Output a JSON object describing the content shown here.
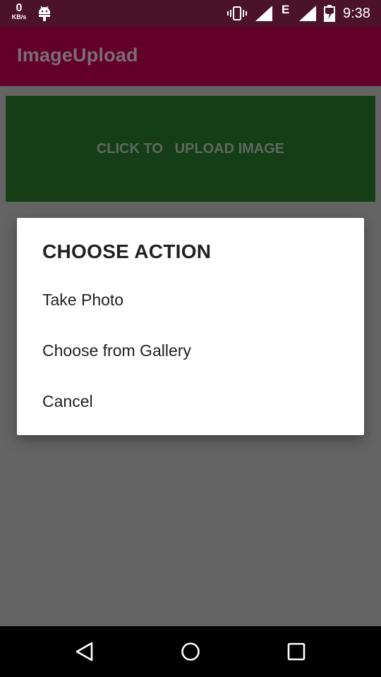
{
  "status_bar": {
    "speed_value": "0",
    "speed_unit": "KB/s",
    "network_type": "E",
    "time": "9:38",
    "icons": [
      "android-icon",
      "vibrate-icon",
      "signal-icon",
      "signal-icon",
      "battery-charging-icon"
    ]
  },
  "app_bar": {
    "title": "ImageUpload",
    "color": "#63002a"
  },
  "upload_button": {
    "label_part1": "CLICK TO",
    "label_part2": "UPLOAD IMAGE",
    "color": "#153d16"
  },
  "dialog": {
    "title": "CHOOSE ACTION",
    "items": [
      "Take Photo",
      "Choose from Gallery",
      "Cancel"
    ]
  },
  "nav_bar": {
    "buttons": [
      "back-icon",
      "home-icon",
      "recent-apps-icon"
    ]
  }
}
